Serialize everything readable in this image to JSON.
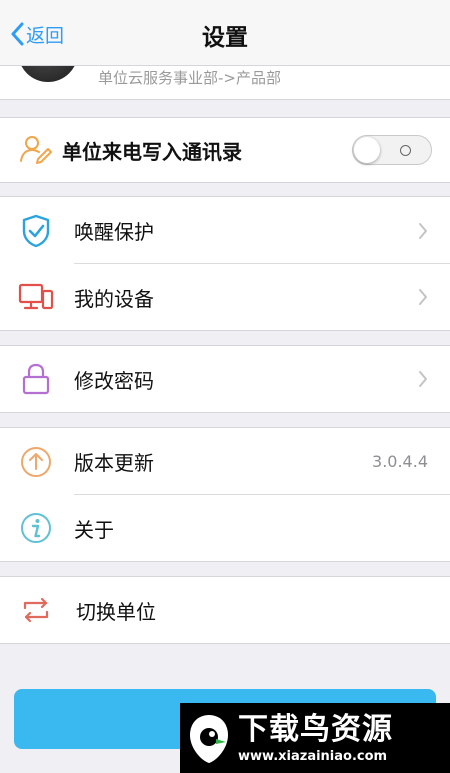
{
  "nav": {
    "back_label": "返回",
    "title": "设置"
  },
  "profile": {
    "department": "单位云服务事业部->产品部"
  },
  "contacts_toggle": {
    "label": "单位来电写入通讯录",
    "on": false
  },
  "security_group": [
    {
      "label": "唤醒保护",
      "icon": "shield-check-icon"
    },
    {
      "label": "我的设备",
      "icon": "devices-icon"
    }
  ],
  "password_group": [
    {
      "label": "修改密码",
      "icon": "lock-icon"
    }
  ],
  "info_group": {
    "update_label": "版本更新",
    "version": "3.0.4.4",
    "about_label": "关于"
  },
  "switch_group": {
    "label": "切换单位"
  },
  "watermark": {
    "name": "下载鸟资源",
    "url": "www.xiazainiao.com"
  },
  "colors": {
    "accent": "#2f9cf5",
    "button": "#39b9ef"
  }
}
